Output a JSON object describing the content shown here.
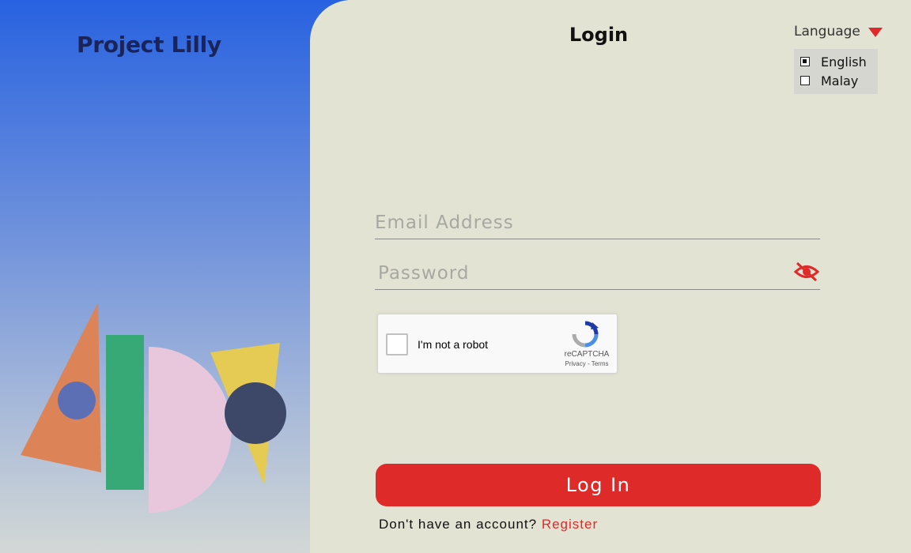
{
  "brand": {
    "name": "Project Lilly"
  },
  "login": {
    "title": "Login"
  },
  "language": {
    "label": "Language",
    "options": [
      {
        "label": "English",
        "selected": true
      },
      {
        "label": "Malay",
        "selected": false
      }
    ]
  },
  "form": {
    "email_placeholder": "Email Address",
    "password_placeholder": "Password",
    "email_value": "",
    "password_value": ""
  },
  "captcha": {
    "label": "I'm not a robot",
    "brand": "reCAPTCHA",
    "privacy": "Privacy",
    "separator": " - ",
    "terms": "Terms"
  },
  "actions": {
    "login_label": "Log In",
    "register_prompt": "Don't have an account?",
    "register_link": "Register"
  },
  "colors": {
    "accent": "#de2a29",
    "panel": "#e2e3d3",
    "brand_text": "#1a2458",
    "gradient_top": "#2862e0"
  },
  "icons": {
    "password_toggle": "eye-slash-icon",
    "language_caret": "caret-down-icon",
    "captcha_logo": "recaptcha-logo-icon"
  }
}
